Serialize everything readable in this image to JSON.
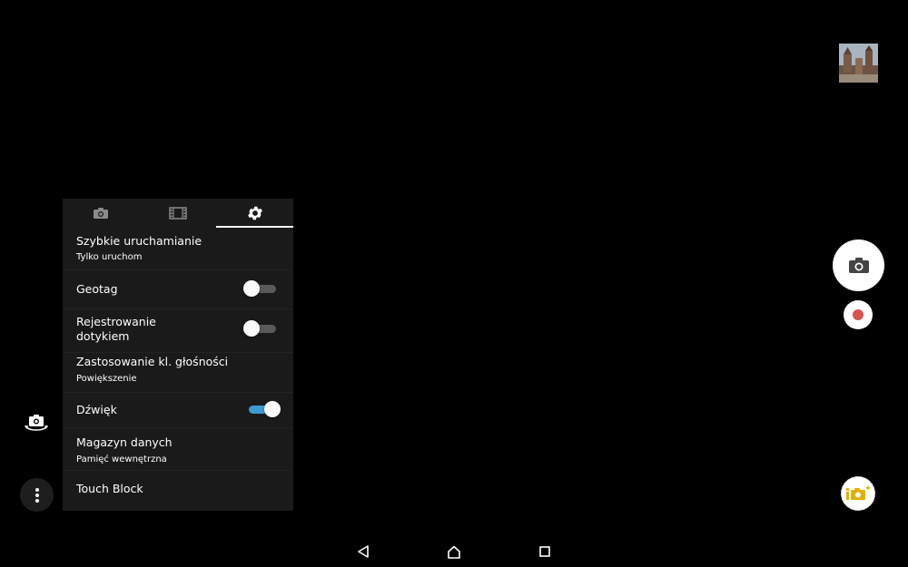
{
  "tabs": [
    {
      "icon": "camera-icon",
      "active": false
    },
    {
      "icon": "film-icon",
      "active": false
    },
    {
      "icon": "gear-icon",
      "active": true
    }
  ],
  "settings": {
    "quick_launch": {
      "title": "Szybkie uruchamianie",
      "value": "Tylko uruchom"
    },
    "geotag": {
      "title": "Geotag",
      "on": false
    },
    "touch_capture": {
      "title_line1": "Rejestrowanie",
      "title_line2": "dotykiem",
      "on": false
    },
    "volume_key": {
      "title": "Zastosowanie kl. głośności",
      "value": "Powiększenie"
    },
    "sound": {
      "title": "Dźwięk",
      "on": true
    },
    "storage": {
      "title": "Magazyn danych",
      "value": "Pamięć wewnętrzna"
    },
    "touch_block": {
      "title": "Touch Block"
    }
  },
  "colors": {
    "accent": "#3e9ad0",
    "record": "#d9534f",
    "panel_bg": "#1a1a1a"
  },
  "icons": {
    "shutter": "camera-icon",
    "record": "record-icon",
    "switch_camera": "switch-camera-icon",
    "menu": "more-vertical-icon",
    "app": "camera-add-on-icon",
    "nav_back": "back-icon",
    "nav_home": "home-icon",
    "nav_recents": "recents-icon"
  }
}
